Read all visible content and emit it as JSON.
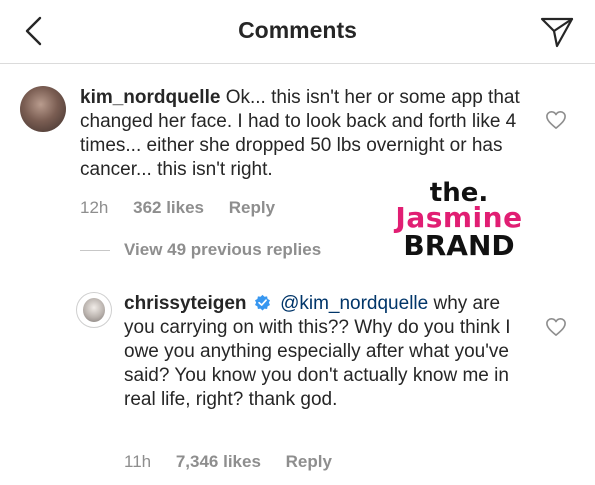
{
  "header": {
    "title": "Comments",
    "back_icon": "chevron-left-icon",
    "share_icon": "paper-plane-icon"
  },
  "comments": [
    {
      "username": "kim_nordquelle",
      "body": "Ok... this isn't her or some app that changed her face. I had to look back and forth like 4 times... either she dropped 50 lbs overnight or has cancer... this isn't right.",
      "time": "12h",
      "likes": "362 likes",
      "reply_label": "Reply"
    },
    {
      "username": "chrissyteigen",
      "verified": true,
      "mention": "@kim_nordquelle",
      "body": "why are you carrying on with this?? Why do you think I owe you anything especially after what you've said? You know you don't actually know me in real life, right? thank god.",
      "time": "11h",
      "likes": "7,346 likes",
      "reply_label": "Reply"
    }
  ],
  "view_replies": "View 49 previous replies",
  "watermark": {
    "line1": "the.",
    "line2": "Jasmine",
    "line3": "BRAND"
  },
  "colors": {
    "text": "#262626",
    "meta": "#8e8e8e",
    "mention": "#003569",
    "verified": "#3897f0",
    "watermark_pink": "#e11e73"
  }
}
